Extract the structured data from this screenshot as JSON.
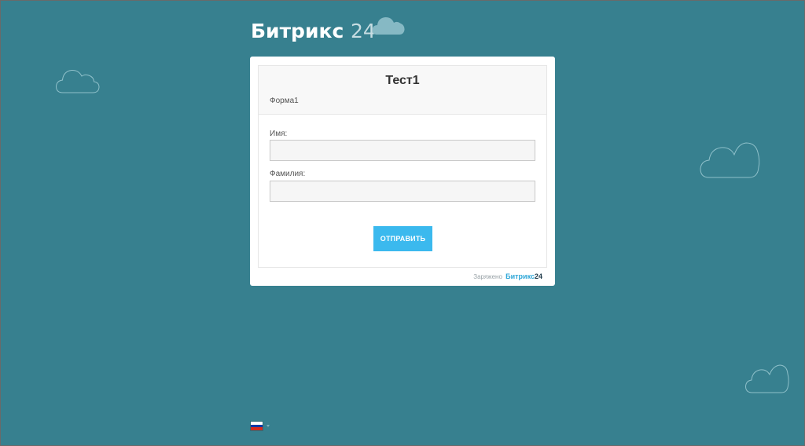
{
  "logo": {
    "name": "Битрикс",
    "number": "24"
  },
  "form": {
    "title": "Тест1",
    "subtitle": "Форма1",
    "fields": [
      {
        "label": "Имя:",
        "value": "",
        "placeholder": ""
      },
      {
        "label": "Фамилия:",
        "value": "",
        "placeholder": ""
      }
    ],
    "submit_label": "ОТПРАВИТЬ"
  },
  "footer": {
    "powered_text": "Заряжено",
    "brand_name": "Битрикс",
    "brand_number": "24"
  },
  "language": {
    "flag": "russia-flag-icon",
    "colors": [
      "#ffffff",
      "#0039a6",
      "#d52b1e"
    ]
  },
  "colors": {
    "background": "#37808f",
    "accent": "#3bb9ee",
    "cloud_stroke": "#8fc0ca",
    "cloud_fill": "#86b9c4"
  }
}
